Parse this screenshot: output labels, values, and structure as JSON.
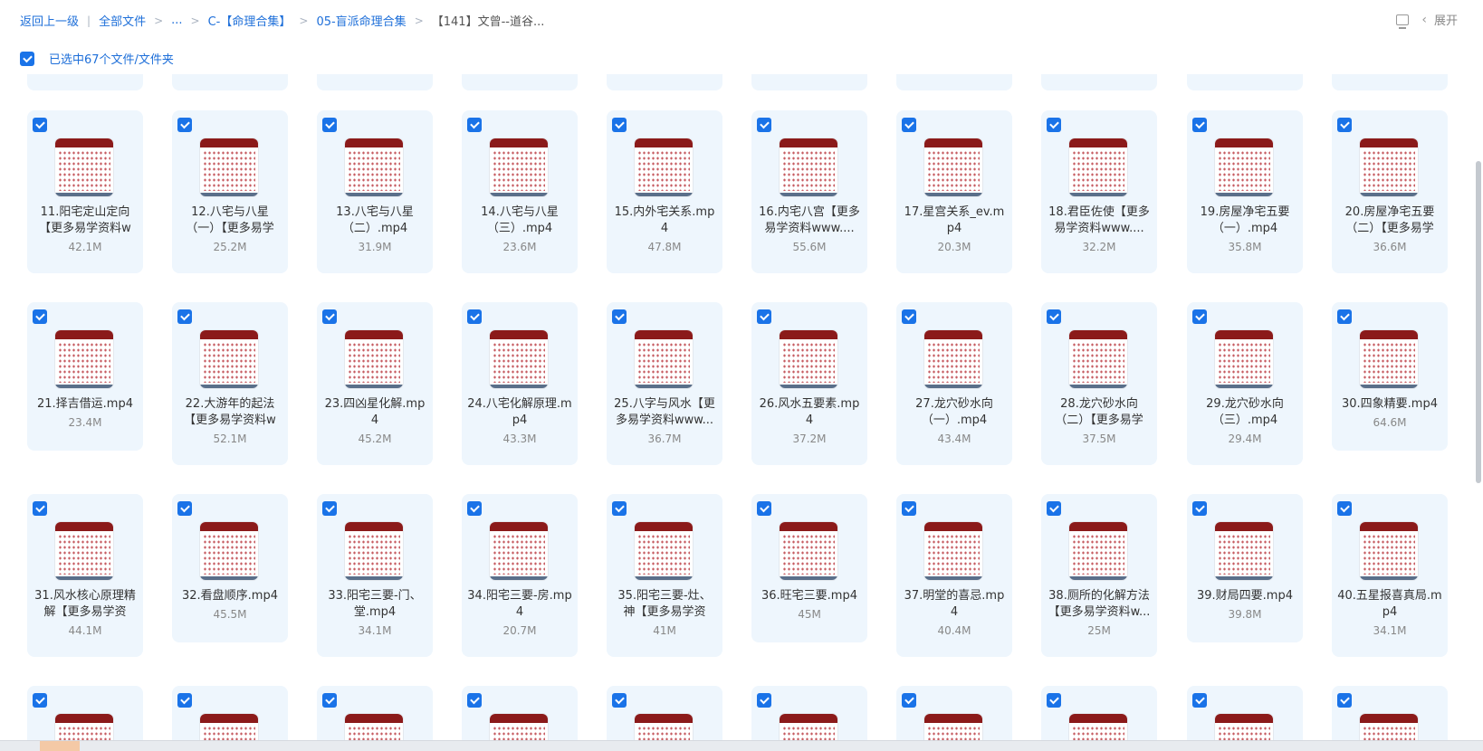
{
  "breadcrumb": {
    "back": "返回上一级",
    "divider": "|",
    "all_files": "全部文件",
    "ellipsis": "...",
    "level1": "C-【命理合集】",
    "level2": "05-盲派命理合集",
    "current": "【141】文曾--道谷...",
    "sep": ">"
  },
  "top_right": {
    "expand_label": "展开"
  },
  "selection": {
    "text": "已选中67个文件/文件夹"
  },
  "colors": {
    "accent": "#1a73e8",
    "link": "#1e6fd9",
    "card_bg": "#eef6fd",
    "thumb_band": "#8b1a1a"
  },
  "files": [
    {
      "name": "11.阳宅定山定向【更多易学资料w",
      "size": "42.1M"
    },
    {
      "name": "12.八宅与八星（一）【更多易学",
      "size": "25.2M"
    },
    {
      "name": "13.八宅与八星（二）.mp4",
      "size": "31.9M"
    },
    {
      "name": "14.八宅与八星（三）.mp4",
      "size": "23.6M"
    },
    {
      "name": "15.内外宅关系.mp4",
      "size": "47.8M"
    },
    {
      "name": "16.内宅八宫【更多易学资料www....",
      "size": "55.6M"
    },
    {
      "name": "17.星宫关系_ev.mp4",
      "size": "20.3M"
    },
    {
      "name": "18.君臣佐使【更多易学资料www....",
      "size": "32.2M"
    },
    {
      "name": "19.房屋净宅五要（一）.mp4",
      "size": "35.8M"
    },
    {
      "name": "20.房屋净宅五要（二）【更多易学",
      "size": "36.6M"
    },
    {
      "name": "21.择吉借运.mp4",
      "size": "23.4M"
    },
    {
      "name": "22.大游年的起法【更多易学资料w",
      "size": "52.1M"
    },
    {
      "name": "23.四凶星化解.mp4",
      "size": "45.2M"
    },
    {
      "name": "24.八宅化解原理.mp4",
      "size": "43.3M"
    },
    {
      "name": "25.八字与风水【更多易学资料www...",
      "size": "36.7M"
    },
    {
      "name": "26.风水五要素.mp4",
      "size": "37.2M"
    },
    {
      "name": "27.龙穴砂水向（一）.mp4",
      "size": "43.4M"
    },
    {
      "name": "28.龙穴砂水向（二）【更多易学",
      "size": "37.5M"
    },
    {
      "name": "29.龙穴砂水向（三）.mp4",
      "size": "29.4M"
    },
    {
      "name": "30.四象精要.mp4",
      "size": "64.6M"
    },
    {
      "name": "31.风水核心原理精解【更多易学资",
      "size": "44.1M"
    },
    {
      "name": "32.看盘顺序.mp4",
      "size": "45.5M"
    },
    {
      "name": "33.阳宅三要-门、堂.mp4",
      "size": "34.1M"
    },
    {
      "name": "34.阳宅三要-房.mp4",
      "size": "20.7M"
    },
    {
      "name": "35.阳宅三要-灶、神【更多易学资",
      "size": "41M"
    },
    {
      "name": "36.旺宅三要.mp4",
      "size": "45M"
    },
    {
      "name": "37.明堂的喜忌.mp4",
      "size": "40.4M"
    },
    {
      "name": "38.厕所的化解方法【更多易学资料w...",
      "size": "25M"
    },
    {
      "name": "39.财局四要.mp4",
      "size": "39.8M"
    },
    {
      "name": "40.五星报喜真局.mp4",
      "size": "34.1M"
    }
  ]
}
